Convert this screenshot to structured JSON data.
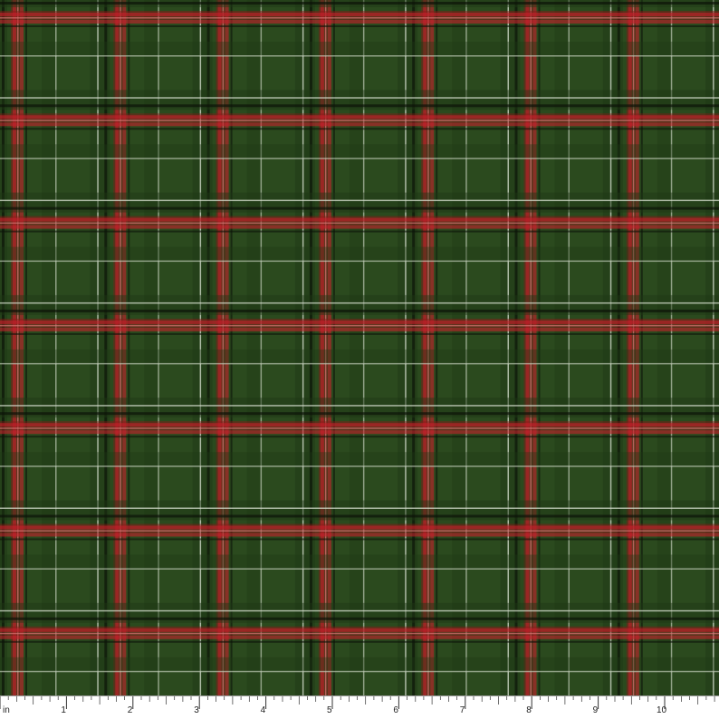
{
  "fabric": {
    "pattern": "tartan-plaid",
    "colors": {
      "ground_green": "#2b4a1e",
      "dark_green": "#1f3816",
      "red": "#c8202c",
      "dark_red": "#8a1a18",
      "pink_line": "#e07a7a",
      "white_line": "#d8e0d0",
      "black_line": "#0c1208"
    }
  },
  "ruler": {
    "unit_label": "in",
    "ticks": [
      "1",
      "2",
      "3",
      "4",
      "5",
      "6",
      "7",
      "8",
      "9",
      "10"
    ],
    "background": "#ffffff",
    "tick_color": "#333333"
  }
}
